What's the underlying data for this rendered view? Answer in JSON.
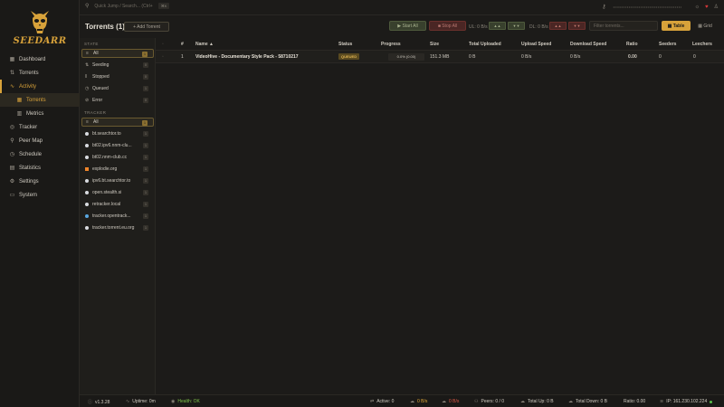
{
  "brand": {
    "logo_text": "SEEDARR",
    "accent": "#d8a23a"
  },
  "topbar": {
    "search_placeholder": "Quick Jump / Search... (Ctrl+",
    "search_shortcut": "⌘K",
    "masked_key": "••••••••••••••••••••••••••••••••••••••••"
  },
  "sidebar": {
    "items": [
      {
        "label": "Dashboard",
        "icon": "grid-icon"
      },
      {
        "label": "Torrents",
        "icon": "arrows-icon"
      },
      {
        "label": "Activity",
        "icon": "pulse-icon"
      },
      {
        "label": "Torrents",
        "icon": "grid-icon"
      },
      {
        "label": "Metrics",
        "icon": "bars-icon"
      },
      {
        "label": "Tracker",
        "icon": "target-icon"
      },
      {
        "label": "Peer Map",
        "icon": "map-icon"
      },
      {
        "label": "Schedule",
        "icon": "clock-icon"
      },
      {
        "label": "Statistics",
        "icon": "chart-icon"
      },
      {
        "label": "Settings",
        "icon": "gear-icon"
      },
      {
        "label": "System",
        "icon": "monitor-icon"
      }
    ]
  },
  "toolbar": {
    "title": "Torrents (1)",
    "add_label": "+ Add Torrent",
    "start_label": "▶ Start All",
    "stop_label": "■ Stop All",
    "ul_label": "UL: 0 B/s",
    "dl_label": "DL: 0 B/s",
    "ul_up": "▲▲",
    "ul_down": "▼▼",
    "dl_up": "▲▲",
    "dl_down": "▼▼",
    "filter_placeholder": "Filter torrents...",
    "table_label": "▦ Table",
    "grid_label": "▦ Grid"
  },
  "filters": {
    "state_header": "STATE",
    "states": [
      {
        "label": "All",
        "count": "1"
      },
      {
        "label": "Seeding",
        "count": "0"
      },
      {
        "label": "Stopped",
        "count": "0"
      },
      {
        "label": "Queued",
        "count": "1"
      },
      {
        "label": "Error",
        "count": "0"
      }
    ],
    "tracker_header": "TRACKER",
    "trackers": [
      {
        "label": "All",
        "count": "1"
      },
      {
        "label": "bt.searchtor.to",
        "count": "1"
      },
      {
        "label": "bt02.ipv6.nnm-clu...",
        "count": "1"
      },
      {
        "label": "bt02.nnm-club.cc",
        "count": "1"
      },
      {
        "label": "explodie.org",
        "count": "1"
      },
      {
        "label": "ipv6.bt.searchtor.to",
        "count": "1"
      },
      {
        "label": "open.stealth.si",
        "count": "1"
      },
      {
        "label": "retracker.local",
        "count": "1"
      },
      {
        "label": "tracker.opentrack...",
        "count": "1"
      },
      {
        "label": "tracker.torrent.eu.org",
        "count": "1"
      }
    ]
  },
  "table": {
    "headers": {
      "num": "#",
      "name": "Name ▲",
      "status": "Status",
      "progress": "Progress",
      "size": "Size",
      "total_uploaded": "Total Uploaded",
      "upload_speed": "Upload Speed",
      "download_speed": "Download Speed",
      "ratio": "Ratio",
      "seeders": "Seeders",
      "leechers": "Leechers"
    },
    "rows": [
      {
        "num": "1",
        "name": "VideoHive - Documentary Style Pack - 58710217",
        "status": "QUEUED",
        "progress_text": "0.0% (0.00)",
        "progress": 0.0,
        "size": "151.3 MB",
        "total_uploaded": "0 B",
        "upload_speed": "0 B/s",
        "download_speed": "0 B/s",
        "ratio": "0.00",
        "seeders": "0",
        "leechers": "0"
      }
    ]
  },
  "statusbar": {
    "version": "v1.3.28",
    "uptime": "Uptime: 0m",
    "health": "Health: OK",
    "active": "Active: 0",
    "down_speed": "0 B/s",
    "up_speed": "0 B/s",
    "peers": "Peers: 0 / 0",
    "total_up": "Total Up: 0 B",
    "total_down": "Total Down: 0 B",
    "ratio": "Ratio: 0.00",
    "ip": "IP: 161.230.102.224"
  }
}
